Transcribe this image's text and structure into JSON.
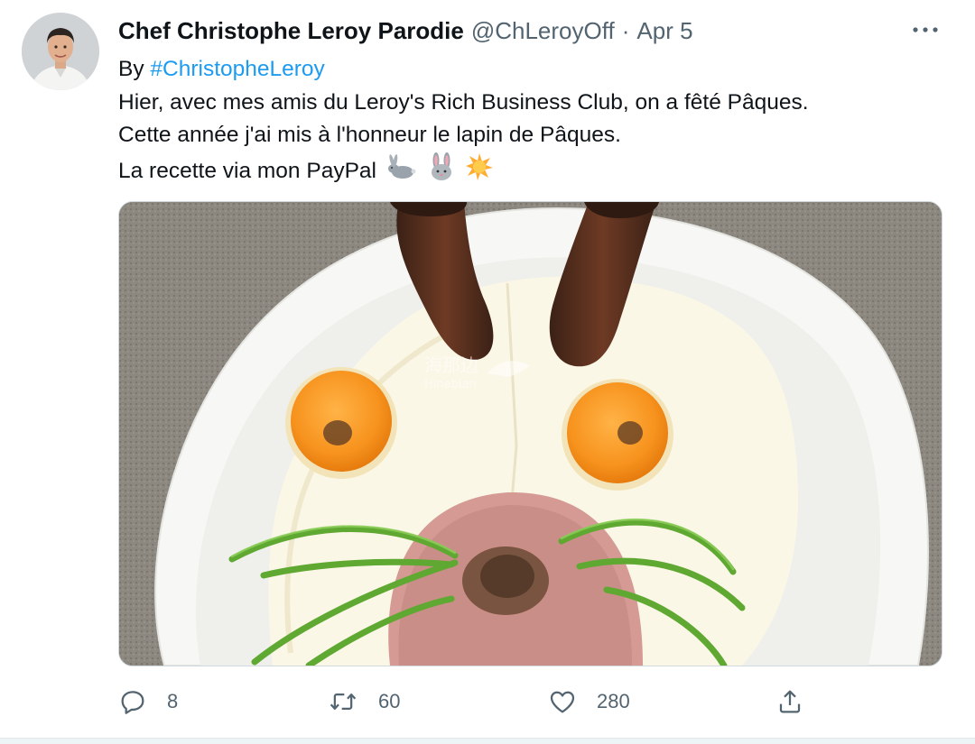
{
  "tweet": {
    "author": {
      "name": "Chef Christophe Leroy Parodie",
      "handle": "@ChLeroyOff",
      "separator": "·",
      "date": "Apr 5"
    },
    "text": {
      "by_prefix": "By ",
      "hashtag": "#ChristopheLeroy",
      "line2": "Hier, avec mes amis du Leroy's Rich Business Club, on a fêté Pâques.",
      "line3": "Cette année j'ai mis à l'honneur le lapin de Pâques.",
      "line4": "La recette via mon PayPal"
    },
    "emojis": [
      "rabbit-emoji",
      "rabbit-face-emoji",
      "sun-emoji"
    ],
    "media": {
      "description_icon": "photo",
      "watermark_cn": "海那边",
      "watermark_en": "Hinabian"
    },
    "actions": {
      "reply_count": "8",
      "retweet_count": "60",
      "like_count": "280"
    }
  },
  "colors": {
    "text_primary": "#0f1419",
    "text_secondary": "#536471",
    "link": "#1d9bf0",
    "border": "#cfd9de"
  }
}
